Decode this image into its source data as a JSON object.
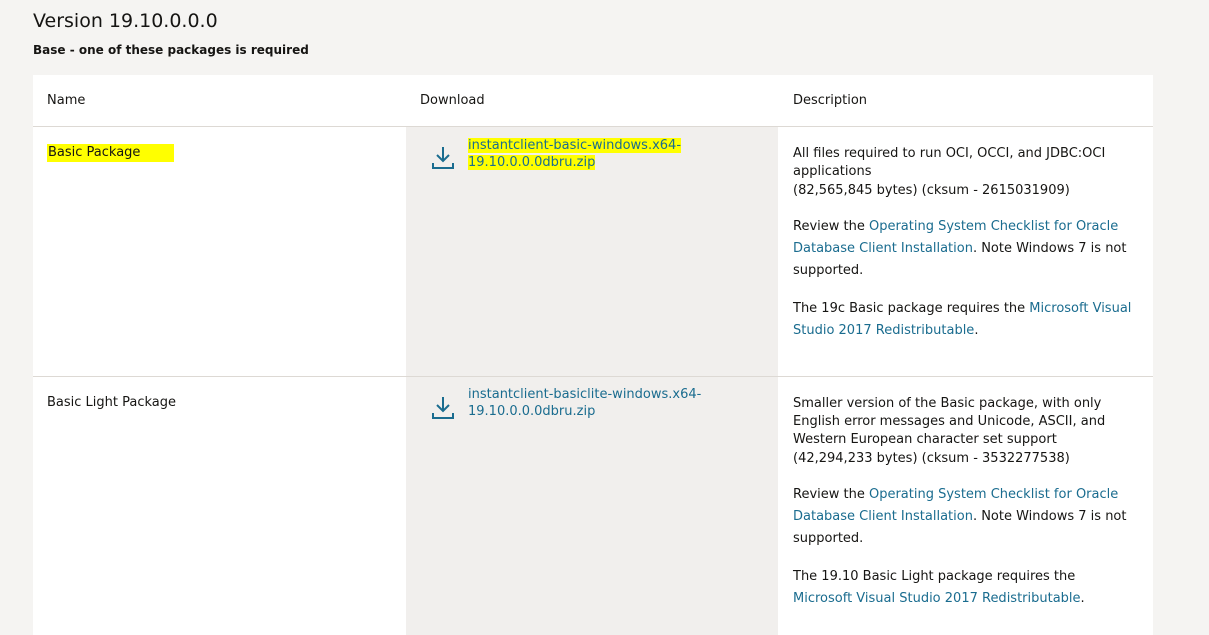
{
  "page": {
    "version_title": "Version 19.10.0.0.0",
    "subtitle": "Base - one of these packages is required"
  },
  "table": {
    "headers": {
      "name": "Name",
      "download": "Download",
      "description": "Description"
    },
    "rows": [
      {
        "name": "Basic Package",
        "download_line1": "instantclient-basic-windows.x64-",
        "download_line2": "19.10.0.0.0dbru.zip",
        "desc_line1": "All files required to run OCI, OCCI, and JDBC:OCI applications",
        "desc_line2": "(82,565,845 bytes) (cksum - 2615031909)",
        "review_prefix": "Review the ",
        "review_link": "Operating System Checklist for Oracle Database Client Installation",
        "review_suffix": ". Note Windows 7 is not supported.",
        "req_prefix": "The 19c Basic package requires the ",
        "req_link": "Microsoft Visual Studio 2017 Redistributable",
        "req_suffix": "."
      },
      {
        "name": "Basic Light Package",
        "download_line1": "instantclient-basiclite-windows.x64-",
        "download_line2": "19.10.0.0.0dbru.zip",
        "desc_line1": "Smaller version of the Basic package, with only English error messages and Unicode, ASCII, and Western European character set support",
        "desc_line2": "(42,294,233 bytes) (cksum - 3532277538)",
        "review_prefix": "Review the ",
        "review_link": "Operating System Checklist for Oracle Database Client Installation",
        "review_suffix": ". Note Windows 7 is not supported.",
        "req_prefix": "The 19.10 Basic Light package requires the ",
        "req_link": "Microsoft Visual Studio 2017 Redistributable",
        "req_suffix": "."
      }
    ]
  },
  "colors": {
    "highlight": "#ffff00",
    "link": "#1a6c8f",
    "download_column_bg": "#f1efed",
    "page_bg": "#f5f4f2"
  },
  "icons": {
    "download": "download-icon"
  }
}
